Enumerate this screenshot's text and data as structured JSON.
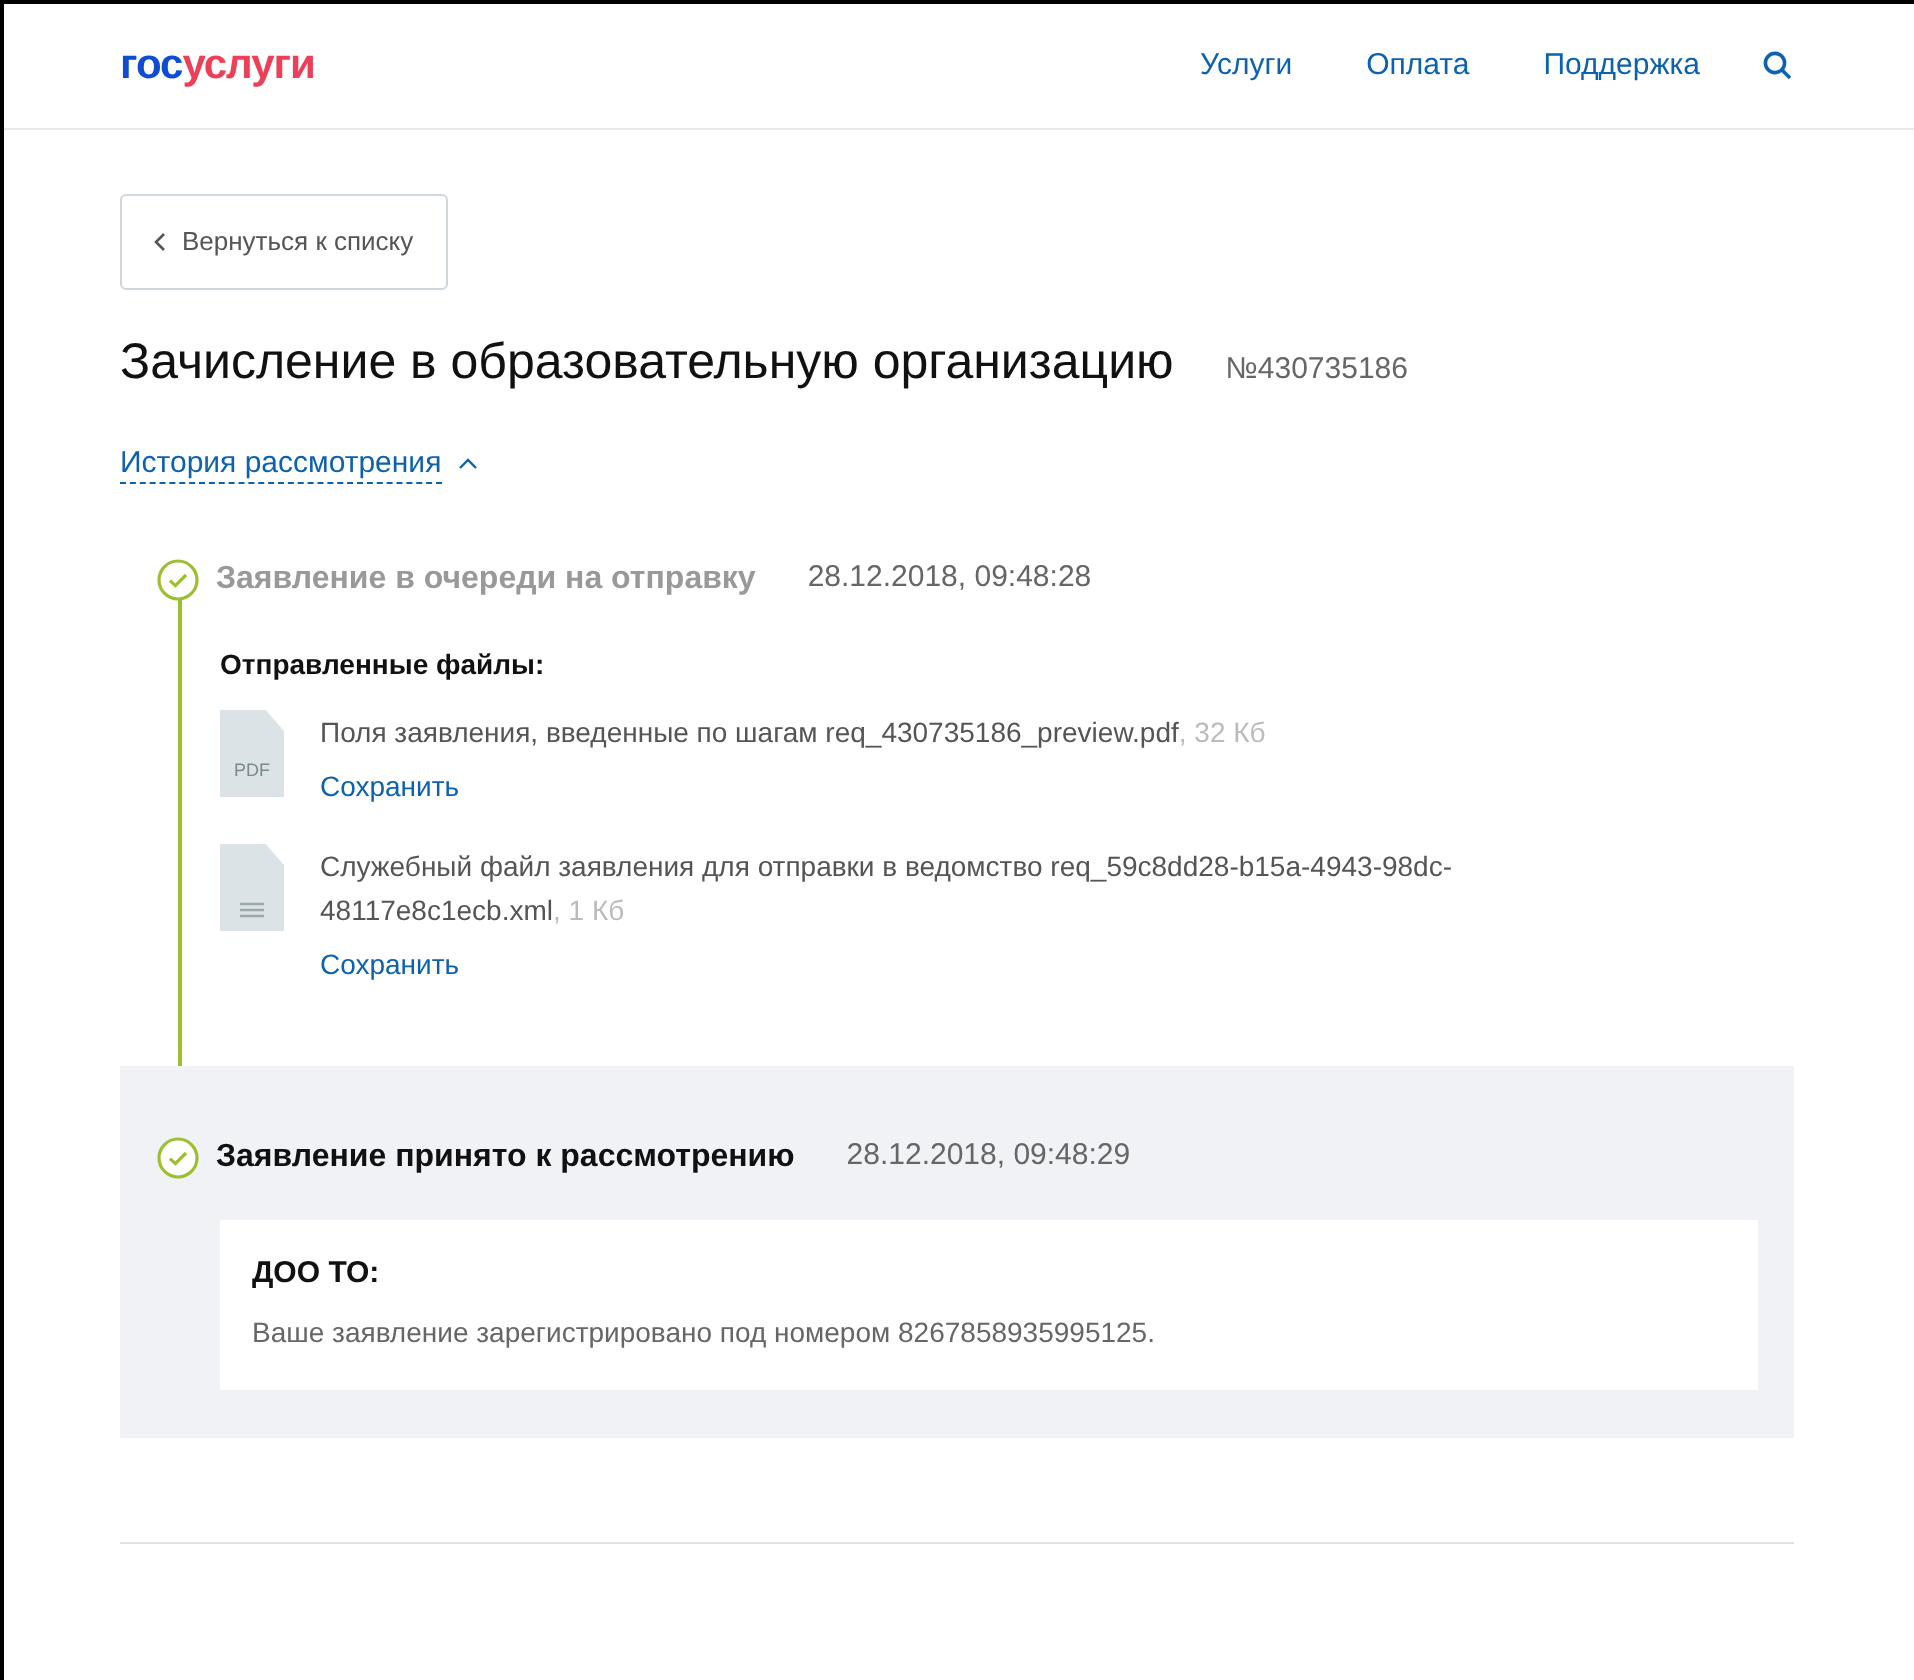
{
  "header": {
    "logo": {
      "part_1": "гос",
      "part_2": "услуги"
    },
    "nav": [
      "Услуги",
      "Оплата",
      "Поддержка"
    ]
  },
  "back_button": "Вернуться к списку",
  "title": "Зачисление в образовательную организацию",
  "order_number": "№430735186",
  "history_link": {
    "label": "История рассмотрения",
    "expanded": true
  },
  "steps": [
    {
      "title": "Заявление в очереди на отправку",
      "time": "28.12.2018, 09:48:28",
      "highlighted": false,
      "files_heading": "Отправленные файлы:",
      "files": [
        {
          "kind": "pdf",
          "icon_label": "PDF",
          "name": "Поля заявления, введенные по шагам req_430735186_preview.pdf",
          "size": ", 32 Кб",
          "save": "Сохранить"
        },
        {
          "kind": "text",
          "name": "Служебный файл заявления для отправки в ведомство req_59c8dd28-b15a-4943-98dc-48117e8c1ecb.xml",
          "size": ", 1 Кб",
          "save": "Сохранить"
        }
      ]
    },
    {
      "title": "Заявление принято к рассмотрению",
      "time": "28.12.2018, 09:48:29",
      "highlighted": true,
      "message": {
        "heading": "ДОО ТО:",
        "text": "Ваше заявление зарегистрировано под номером 8267858935995125."
      }
    }
  ]
}
